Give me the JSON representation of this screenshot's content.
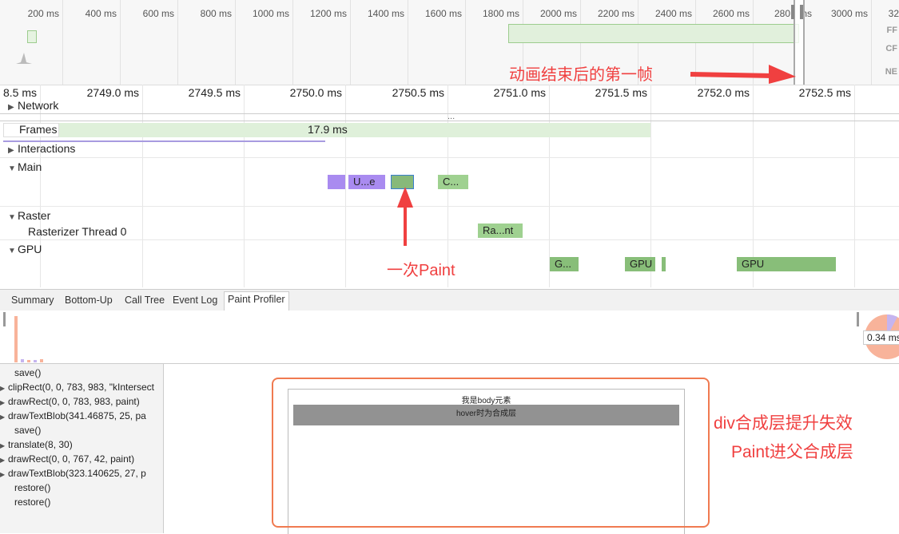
{
  "overview": {
    "ticks": [
      "200 ms",
      "400 ms",
      "600 ms",
      "800 ms",
      "1000 ms",
      "1200 ms",
      "1400 ms",
      "1600 ms",
      "1800 ms",
      "2000 ms",
      "2200 ms",
      "2400 ms",
      "2600 ms",
      "280",
      "ns",
      "3000 ms",
      "32"
    ],
    "side_labels": [
      "FF",
      "CF",
      "NE"
    ]
  },
  "ruler": {
    "ticks": [
      "8.5 ms",
      "2749.0 ms",
      "2749.5 ms",
      "2750.0 ms",
      "2750.5 ms",
      "2751.0 ms",
      "2751.5 ms",
      "2752.0 ms",
      "2752.5 ms"
    ]
  },
  "tracks": {
    "network": "Network",
    "frames": "Frames",
    "frame_duration": "17.9 ms",
    "interactions": "Interactions",
    "main": "Main",
    "raster": "Raster",
    "rasterizer_thread": "Rasterizer Thread 0",
    "gpu": "GPU",
    "ellipsis": "..."
  },
  "events": {
    "main": [
      "",
      "U...e",
      "",
      "C..."
    ],
    "raster": [
      "Ra...nt"
    ],
    "gpu": [
      "G...",
      "GPU",
      "",
      "GPU"
    ]
  },
  "tabs": [
    "Summary",
    "Bottom-Up",
    "Call Tree",
    "Event Log",
    "Paint Profiler"
  ],
  "active_tab": "Paint Profiler",
  "pie_label": "0.34 ms",
  "commands": [
    {
      "text": "save()",
      "expand": false
    },
    {
      "text": "clipRect(0, 0, 783, 983, \"kIntersect",
      "expand": true
    },
    {
      "text": "drawRect(0, 0, 783, 983, paint)",
      "expand": true
    },
    {
      "text": "drawTextBlob(341.46875, 25, pa",
      "expand": true
    },
    {
      "text": "save()",
      "expand": false
    },
    {
      "text": "translate(8, 30)",
      "expand": true
    },
    {
      "text": "drawRect(0, 0, 767, 42, paint)",
      "expand": true
    },
    {
      "text": "drawTextBlob(323.140625, 27, p",
      "expand": true
    },
    {
      "text": "restore()",
      "expand": false
    },
    {
      "text": "restore()",
      "expand": false
    }
  ],
  "preview": {
    "body_text": "我是body元素",
    "div_text": "hover时为合成层"
  },
  "annotations": {
    "first_frame": "动画结束后的第一帧",
    "one_paint": "一次Paint",
    "fail_line1": "div合成层提升失效",
    "fail_line2": "Paint进父合成层"
  },
  "colors": {
    "annotation_red": "#f04040",
    "frame_green": "#d9ecd5",
    "purple": "#a98bf0",
    "paint_green": "#87b97a",
    "gpu_green": "#88be79"
  }
}
